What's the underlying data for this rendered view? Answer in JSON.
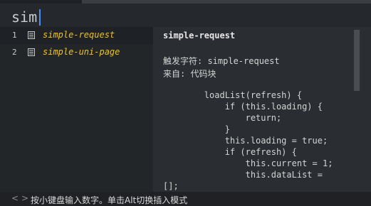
{
  "editor": {
    "typed_text": "sim"
  },
  "suggestions": [
    {
      "number": "1",
      "label": "simple-request",
      "icon": "document-icon"
    },
    {
      "number": "2",
      "label": "simple-uni-page",
      "icon": "document-icon"
    }
  ],
  "detail": {
    "title": "simple-request",
    "trigger_line": "触发字符: simple-request",
    "source_line": "来自: 代码块",
    "code_lines": [
      "        loadList(refresh) {",
      "            if (this.loading) {",
      "                return;",
      "            }",
      "            this.loading = true;",
      "            if (refresh) {",
      "                this.current = 1;",
      "                this.dataList =",
      "[];"
    ]
  },
  "status_bar": {
    "prev_label": "<",
    "next_label": ">",
    "hint": "按小键盘输入数字。单击Alt切换插入模式"
  },
  "colors": {
    "accent_caret": "#4b8df8",
    "highlight_text": "#f0c419"
  }
}
